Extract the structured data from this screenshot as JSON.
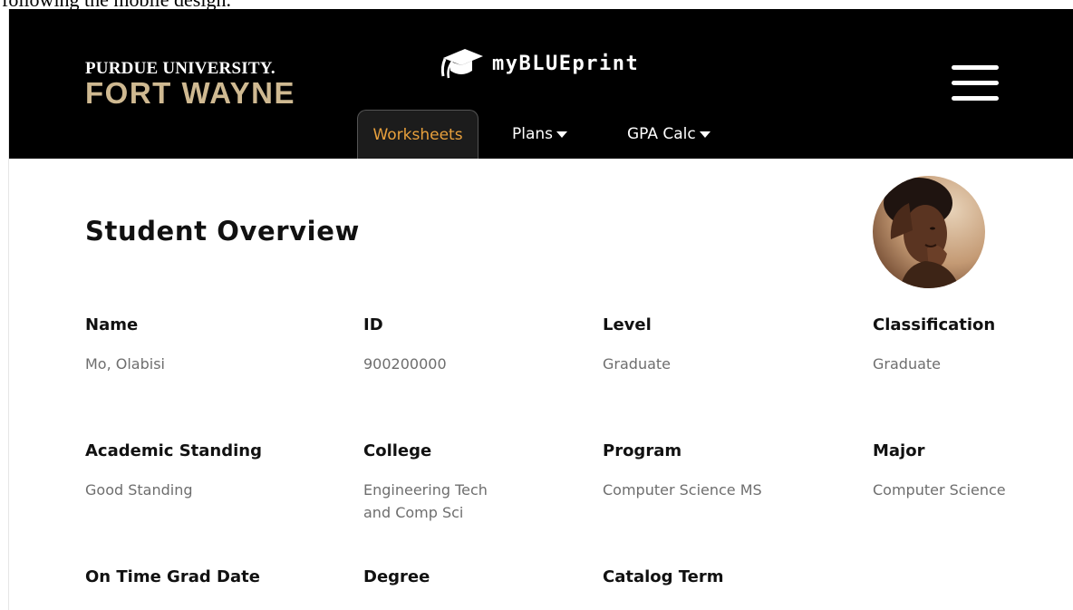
{
  "caption": "following the mobile design.",
  "header": {
    "university_line1": "PURDUE UNIVERSITY.",
    "university_line2": "FORT WAYNE",
    "app_name": "myBLUEprint",
    "app_icon": "graduation-cap-icon",
    "menu_icon": "hamburger-menu-icon"
  },
  "nav": {
    "tabs": [
      {
        "label": "Worksheets",
        "active": true
      },
      {
        "label": "Plans",
        "dropdown": true
      },
      {
        "label": "GPA Calc",
        "dropdown": true
      }
    ]
  },
  "overview": {
    "title": "Student Overview",
    "avatar_icon": "student-avatar",
    "fields": [
      {
        "label": "Name",
        "value": "Mo, Olabisi"
      },
      {
        "label": "ID",
        "value": "900200000"
      },
      {
        "label": "Level",
        "value": "Graduate"
      },
      {
        "label": "Classification",
        "value": "Graduate"
      },
      {
        "label": "Academic Standing",
        "value": "Good Standing"
      },
      {
        "label": "College",
        "value": "Engineering Tech and Comp Sci"
      },
      {
        "label": "Program",
        "value": "Computer Science MS"
      },
      {
        "label": "Major",
        "value": "Computer Science"
      },
      {
        "label": "On Time Grad Date",
        "value": ""
      },
      {
        "label": "Degree",
        "value": ""
      },
      {
        "label": "Catalog Term",
        "value": ""
      }
    ]
  },
  "colors": {
    "header_bg": "#000000",
    "brand_gold": "#cfb991",
    "active_tab_text": "#e8a03c"
  }
}
